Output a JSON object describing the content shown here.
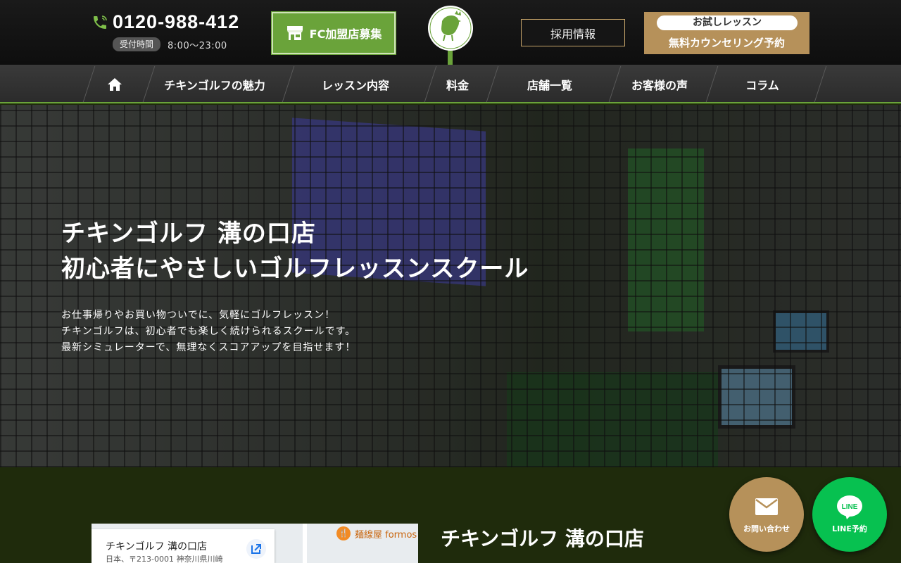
{
  "header": {
    "phone": "0120-988-412",
    "hours_label": "受付時間",
    "hours_value": "8:00～23:00",
    "fc_button": "FC加盟店募集",
    "recruit_button": "採用情報",
    "trial_pill": "お試しレッスン",
    "trial_main": "無料カウンセリング予約"
  },
  "nav": {
    "items": [
      {
        "label": "チキンゴルフの魅力"
      },
      {
        "label": "レッスン内容"
      },
      {
        "label": "料金"
      },
      {
        "label": "店舗一覧"
      },
      {
        "label": "お客様の声"
      },
      {
        "label": "コラム"
      }
    ]
  },
  "hero": {
    "title_line1": "チキンゴルフ 溝の口店",
    "title_line2": "初心者にやさしいゴルフレッスンスクール",
    "text_line1": "お仕事帰りやお買い物ついでに、気軽にゴルフレッスン！",
    "text_line2": "チキンゴルフは、初心者でも楽しく続けられるスクールです。",
    "text_line3": "最新シミュレーターで、無理なくスコアアップを目指せます！"
  },
  "map": {
    "title": "チキンゴルフ 溝の口店",
    "address": "日本、〒213-0001 神奈川県川崎",
    "poi": "麺線屋 formos"
  },
  "store": {
    "title": "チキンゴルフ 溝の口店"
  },
  "fabs": {
    "mail_label": "お問い合わせ",
    "line_label": "LINE予約",
    "line_icon_text": "LINE"
  },
  "colors": {
    "accent_green": "#6aa33a",
    "gold": "#b6915a",
    "line_green": "#07c150",
    "footer_bg": "#1f2b0c"
  }
}
